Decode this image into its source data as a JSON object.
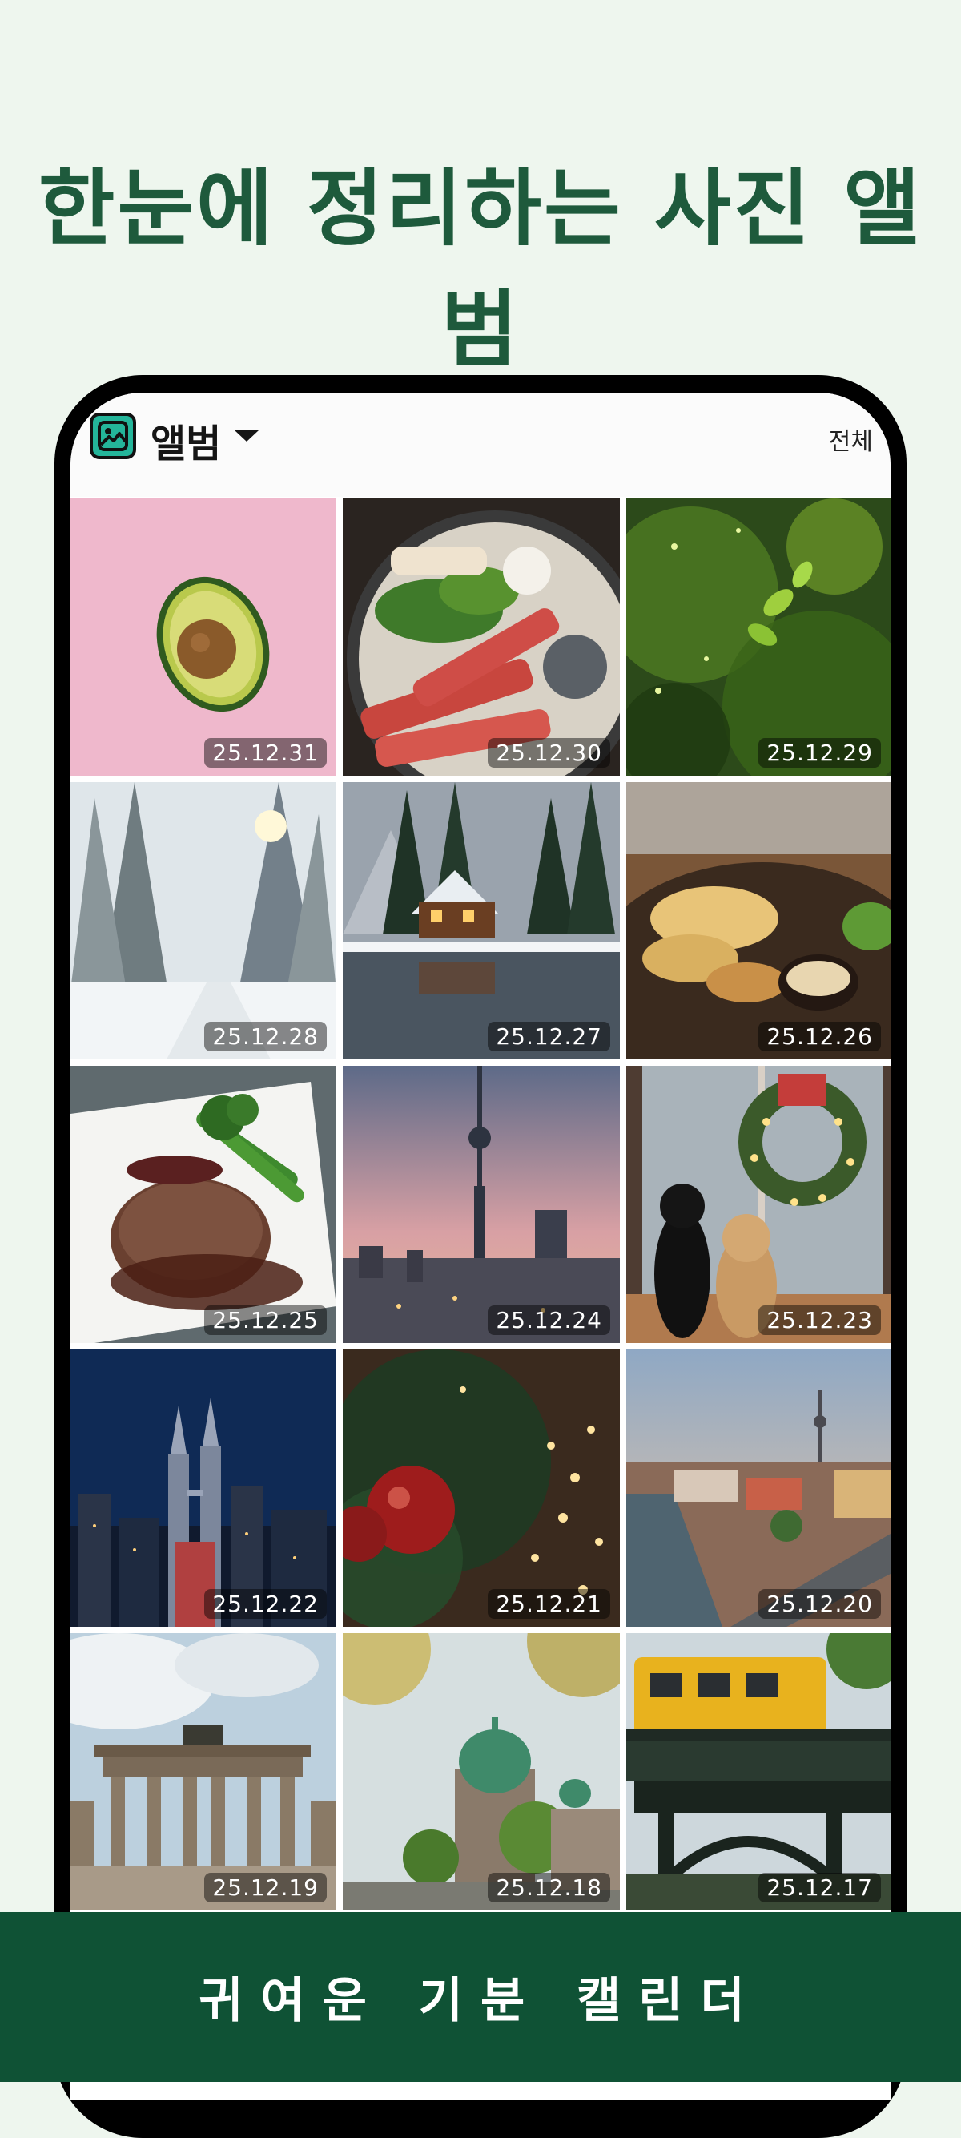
{
  "headline": "한눈에 정리하는 사진 앨범",
  "app": {
    "album_title": "앨범",
    "filter_label": "전체"
  },
  "photos": [
    {
      "date": "25.12.31",
      "subject": "avocado"
    },
    {
      "date": "25.12.30",
      "subject": "shabu-shabu"
    },
    {
      "date": "25.12.29",
      "subject": "green-foliage"
    },
    {
      "date": "25.12.28",
      "subject": "snowy-forest"
    },
    {
      "date": "25.12.27",
      "subject": "lake-cabin"
    },
    {
      "date": "25.12.26",
      "subject": "chicken-dish"
    },
    {
      "date": "25.12.25",
      "subject": "steak"
    },
    {
      "date": "25.12.24",
      "subject": "tv-tower-skyline"
    },
    {
      "date": "25.12.23",
      "subject": "dogs-wreath"
    },
    {
      "date": "25.12.22",
      "subject": "night-city-towers"
    },
    {
      "date": "25.12.21",
      "subject": "christmas-ornament"
    },
    {
      "date": "25.12.20",
      "subject": "city-river-aerial"
    },
    {
      "date": "25.12.19",
      "subject": "brandenburg-gate"
    },
    {
      "date": "25.12.18",
      "subject": "berlin-cathedral"
    },
    {
      "date": "25.12.17",
      "subject": "yellow-train"
    }
  ],
  "footer": "귀여운 기분 캘린더",
  "colors": {
    "background": "#eef6ee",
    "headline": "#1e5a3c",
    "footer": "#0f5235",
    "app_icon": "#24b59a"
  }
}
